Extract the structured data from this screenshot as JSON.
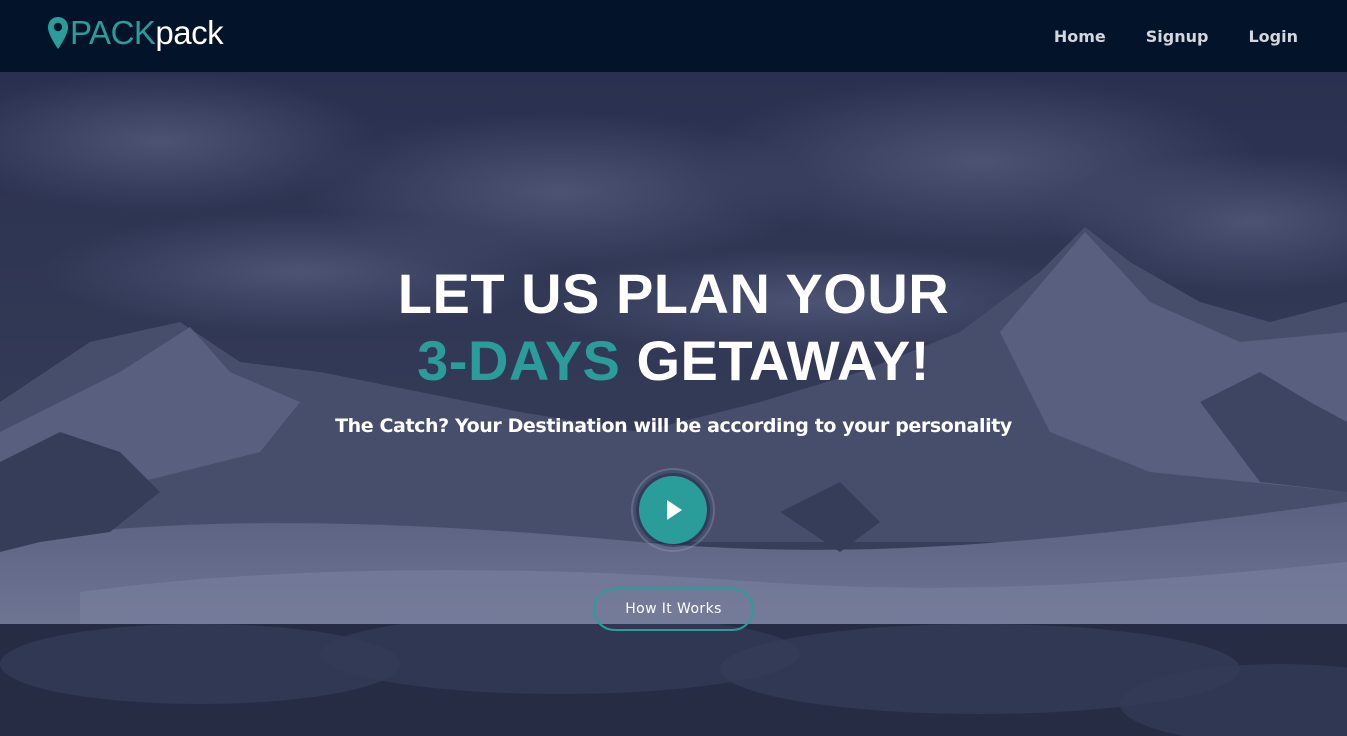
{
  "brand": {
    "name_strong": "PACK",
    "name_light": "pack",
    "icon": "location-pin-icon"
  },
  "nav": {
    "items": [
      {
        "label": "Home"
      },
      {
        "label": "Signup"
      },
      {
        "label": "Login"
      }
    ]
  },
  "hero": {
    "headline_line1": "LET US PLAN YOUR",
    "headline_accent": "3-DAYS",
    "headline_line2_rest": " GETAWAY!",
    "subtitle": "The Catch? Your Destination will be according to your personality",
    "play_icon": "play-icon",
    "cta_label": "How It Works"
  },
  "colors": {
    "accent": "#2a9d9b",
    "navbar_bg": "#03142a",
    "overlay": "#1d2236",
    "text": "#ffffff",
    "nav_text": "#d3d6dc"
  }
}
